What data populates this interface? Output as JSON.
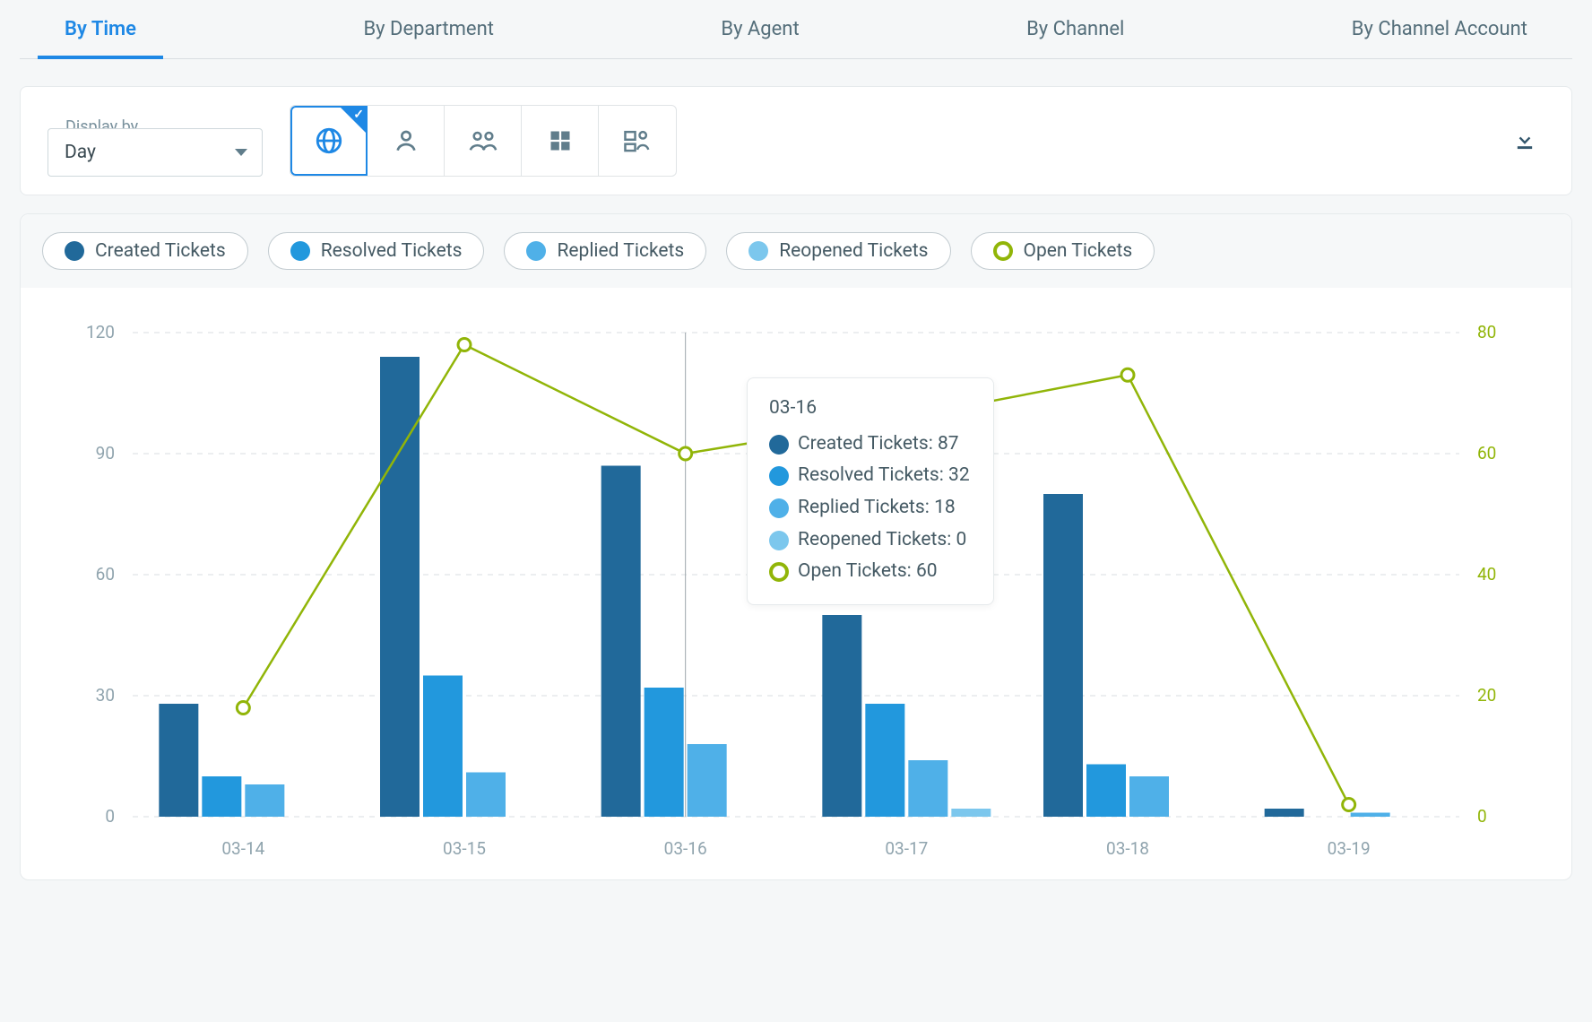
{
  "tabs": [
    {
      "label": "By Time",
      "active": true
    },
    {
      "label": "By Department",
      "active": false
    },
    {
      "label": "By Agent",
      "active": false
    },
    {
      "label": "By Channel",
      "active": false
    },
    {
      "label": "By Channel Account",
      "active": false
    }
  ],
  "toolbar": {
    "display_label": "Display by",
    "display_value": "Day"
  },
  "legend": {
    "created": {
      "label": "Created Tickets",
      "color": "#21699a"
    },
    "resolved": {
      "label": "Resolved Tickets",
      "color": "#2298dd"
    },
    "replied": {
      "label": "Replied Tickets",
      "color": "#4fb0e8"
    },
    "reopened": {
      "label": "Reopened Tickets",
      "color": "#7cc7ed"
    },
    "open": {
      "label": "Open Tickets",
      "color": "#91b508"
    }
  },
  "tooltip": {
    "title": "03-16",
    "created": "Created Tickets: 87",
    "resolved": "Resolved Tickets: 32",
    "replied": "Replied Tickets: 18",
    "reopened": "Reopened Tickets: 0",
    "open": "Open Tickets: 60"
  },
  "chart_data": {
    "type": "bar+line",
    "categories": [
      "03-14",
      "03-15",
      "03-16",
      "03-17",
      "03-18",
      "03-19"
    ],
    "y_left": {
      "label": "",
      "ticks": [
        0,
        30,
        60,
        90,
        120
      ]
    },
    "y_right": {
      "label": "",
      "ticks": [
        0,
        20,
        40,
        60,
        80
      ]
    },
    "bar_series": [
      {
        "name": "Created Tickets",
        "axis": "left",
        "color": "#21699a",
        "values": [
          28,
          114,
          87,
          50,
          80,
          2
        ]
      },
      {
        "name": "Resolved Tickets",
        "axis": "left",
        "color": "#2298dd",
        "values": [
          10,
          35,
          32,
          28,
          13,
          0
        ]
      },
      {
        "name": "Replied Tickets",
        "axis": "left",
        "color": "#4fb0e8",
        "values": [
          8,
          11,
          18,
          14,
          10,
          1
        ]
      },
      {
        "name": "Reopened Tickets",
        "axis": "left",
        "color": "#7cc7ed",
        "values": [
          0,
          0,
          0,
          2,
          0,
          0
        ]
      }
    ],
    "line_series": [
      {
        "name": "Open Tickets",
        "axis": "right",
        "color": "#91b508",
        "values": [
          18,
          78,
          60,
          66,
          73,
          2
        ]
      }
    ],
    "focused_category": "03-16"
  }
}
